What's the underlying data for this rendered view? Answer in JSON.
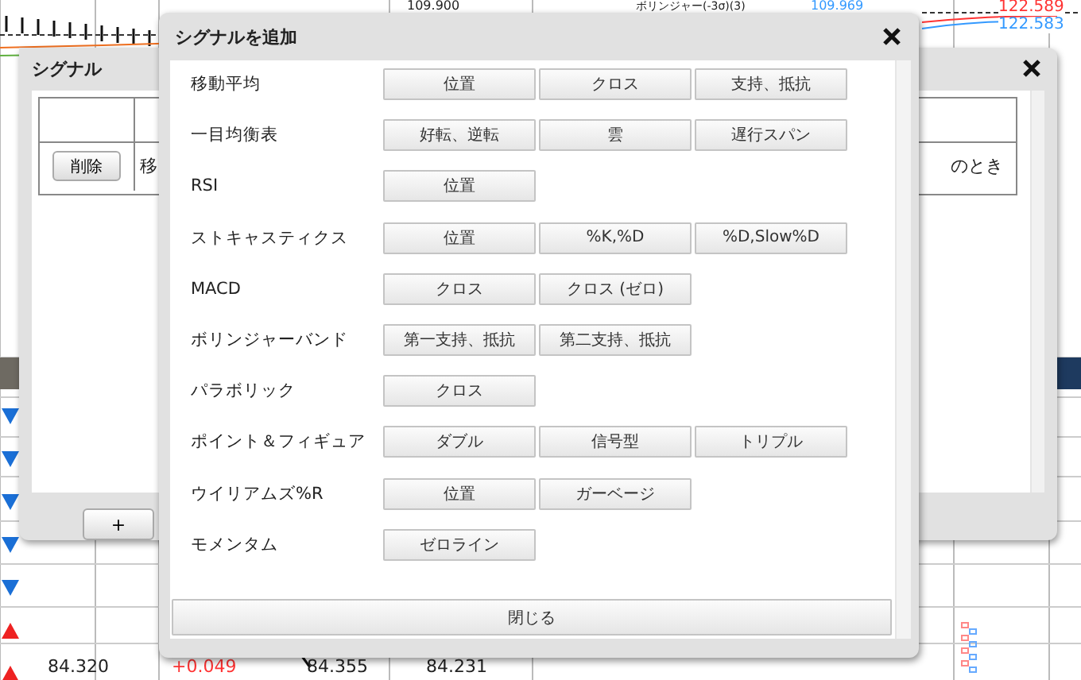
{
  "background": {
    "price_labels": [
      {
        "text": "109.900",
        "color": "#222222"
      },
      {
        "text": "109.969",
        "color": "#3399ff"
      },
      {
        "text": "122.589",
        "color": "#ff3333"
      },
      {
        "text": "122.583",
        "color": "#3399ff"
      }
    ],
    "indicator_label": "ボリンジャー(-3σ)(3)",
    "markers": [
      {
        "rising": false
      },
      {
        "rising": false
      },
      {
        "rising": false
      },
      {
        "rising": false
      },
      {
        "rising": false
      },
      {
        "rising": true
      },
      {
        "rising": true
      }
    ],
    "bottom_row": [
      "84.320",
      "+0.049",
      "84.355",
      "84.231"
    ]
  },
  "signal_window": {
    "title": "シグナル",
    "row": {
      "delete_button": "削除",
      "cell_1": "移",
      "cell_2": "のとき"
    },
    "add_button": "+"
  },
  "add_signal_dialog": {
    "title": "シグナルを追加",
    "rows": [
      {
        "label": "移動平均",
        "buttons": [
          "位置",
          "クロス",
          "支持、抵抗"
        ]
      },
      {
        "label": "一目均衡表",
        "buttons": [
          "好転、逆転",
          "雲",
          "遅行スパン"
        ]
      },
      {
        "label": "RSI",
        "buttons": [
          "位置"
        ]
      },
      {
        "label": "ストキャスティクス",
        "buttons": [
          "位置",
          "%K,%D",
          "%D,Slow%D"
        ]
      },
      {
        "label": "MACD",
        "buttons": [
          "クロス",
          "クロス (ゼロ)"
        ]
      },
      {
        "label": "ボリンジャーバンド",
        "buttons": [
          "第一支持、抵抗",
          "第二支持、抵抗"
        ]
      },
      {
        "label": "パラボリック",
        "buttons": [
          "クロス"
        ]
      },
      {
        "label": "ポイント＆フィギュア",
        "buttons": [
          "ダブル",
          "信号型",
          "トリプル"
        ]
      },
      {
        "label": "ウイリアムズ%R",
        "buttons": [
          "位置",
          "ガーベージ"
        ]
      },
      {
        "label": "モメンタム",
        "buttons": [
          "ゼロライン"
        ]
      }
    ],
    "close_button": "閉じる"
  }
}
